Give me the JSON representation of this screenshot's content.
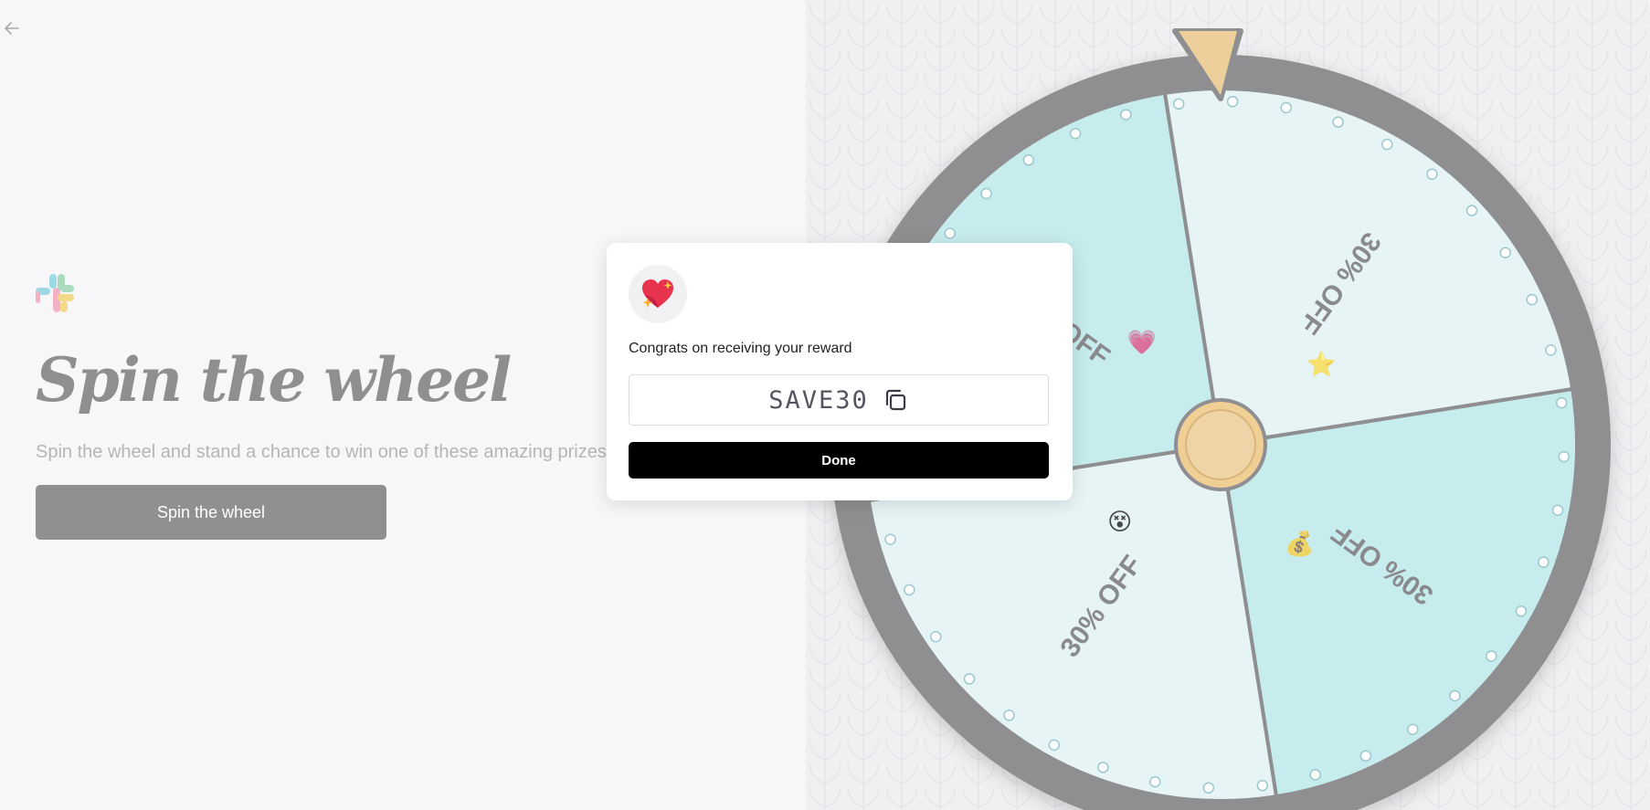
{
  "nav": {
    "back_icon": "arrow-left-icon"
  },
  "hero": {
    "logo_icon": "slack-logo-icon",
    "title": "Spin the wheel",
    "subtitle": "Spin the wheel and stand a chance to win one of these amazing prizes",
    "spin_button_label": "Spin the wheel"
  },
  "wheel": {
    "segments": [
      {
        "label": "30% OFF",
        "icon": "heart-icon"
      },
      {
        "label": "30% OFF",
        "icon": "star-icon"
      },
      {
        "label": "30% OFF",
        "icon": "money-bag-icon"
      },
      {
        "label": "30% OFF",
        "icon": "face-icon"
      }
    ],
    "colors": {
      "rim": "#8f8f91",
      "segment_dark": "#c6ecee",
      "segment_light": "#e6f4f6",
      "pointer": "#eccf9a",
      "hub": "#f0cf95"
    }
  },
  "modal": {
    "icon": "sparkling-heart-icon",
    "message": "Congrats on receiving your reward",
    "code": "SAVE30",
    "copy_icon": "copy-icon",
    "done_label": "Done"
  }
}
